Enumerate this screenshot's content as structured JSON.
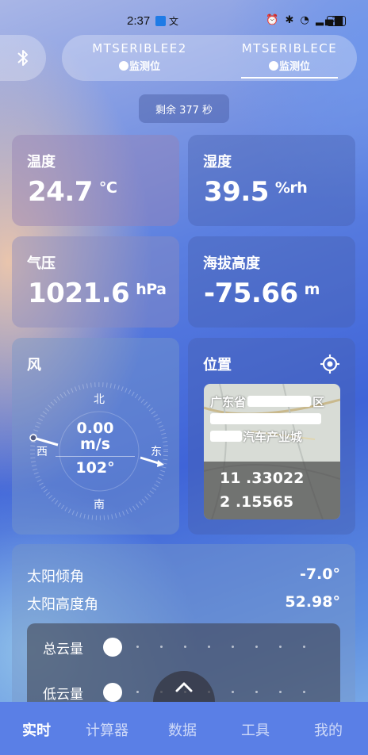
{
  "status_bar": {
    "time": "2:37",
    "ime": "文",
    "battery": "24"
  },
  "devices": [
    {
      "name": "MTSERIBLEE2",
      "sub": "监测位",
      "selected": false
    },
    {
      "name": "MTSERIBLECE",
      "sub": "监测位",
      "selected": true
    }
  ],
  "remaining": "剩余 377 秒",
  "temperature": {
    "label": "温度",
    "value": "24.7",
    "unit": "℃"
  },
  "humidity": {
    "label": "湿度",
    "value": "39.5",
    "unit": "%rh"
  },
  "pressure": {
    "label": "气压",
    "value": "1021.6",
    "unit": "hPa"
  },
  "altitude": {
    "label": "海拔高度",
    "value": "-75.66",
    "unit": "m"
  },
  "wind": {
    "label": "风",
    "speed": "0.00",
    "speed_unit": "m/s",
    "direction": "102°",
    "compass": {
      "north": "北",
      "south": "南",
      "east": "东",
      "west": "西"
    }
  },
  "location": {
    "label": "位置",
    "address_line1": "广东省",
    "address_line1_end": "区",
    "address_line3": "汽车产业城",
    "lon": "11 .33022",
    "lat": "2 .15565"
  },
  "sun": {
    "tilt_label": "太阳倾角",
    "tilt_value": "-7.0°",
    "elevation_label": "太阳高度角",
    "elevation_value": "52.98°"
  },
  "clouds": {
    "total_label": "总云量",
    "low_label": "低云量"
  },
  "nav": [
    "实时",
    "计算器",
    "数据",
    "工具",
    "我的"
  ],
  "nav_active": 0
}
